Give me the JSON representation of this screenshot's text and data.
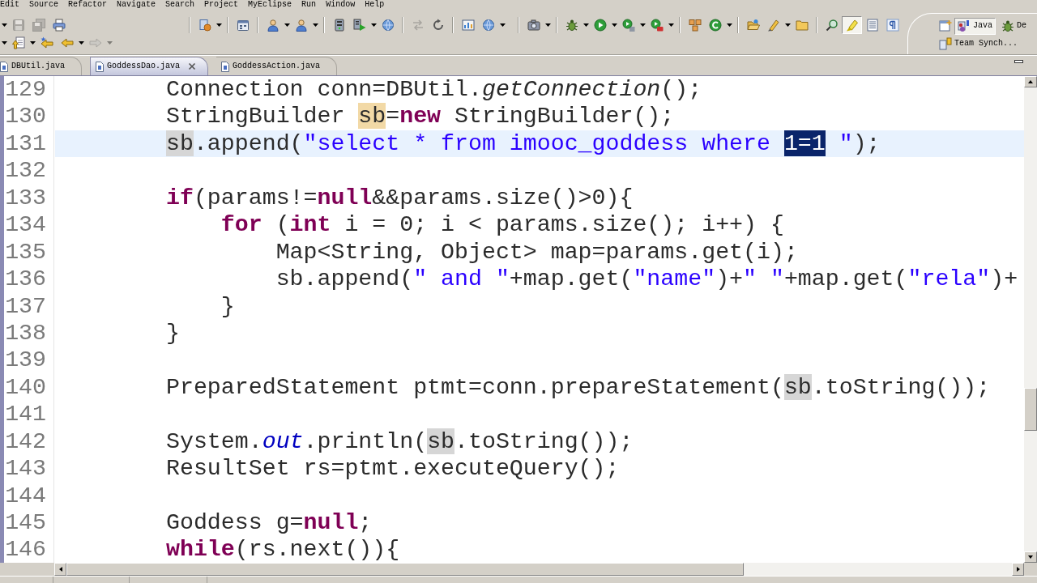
{
  "menu": [
    "Edit",
    "Source",
    "Refactor",
    "Navigate",
    "Search",
    "Project",
    "MyEclipse",
    "Run",
    "Window",
    "Help"
  ],
  "toolbar": [
    {
      "sections": [
        {
          "groups": [
            {
              "items": [
                {
                  "kind": "save",
                  "disabled": true,
                  "dropdown": false,
                  "pressed": false
                },
                {
                  "kind": "save-all",
                  "disabled": true,
                  "dropdown": false,
                  "pressed": false
                },
                {
                  "kind": "print",
                  "disabled": false,
                  "dropdown": false,
                  "pressed": false
                }
              ]
            }
          ]
        },
        {
          "groups": [
            {
              "items": [
                {
                  "kind": "document",
                  "disabled": false,
                  "dropdown": true,
                  "pressed": false
                }
              ]
            },
            {
              "items": [
                {
                  "kind": "calendar",
                  "disabled": false,
                  "dropdown": false,
                  "pressed": false
                }
              ]
            },
            {
              "items": [
                {
                  "kind": "person",
                  "disabled": false,
                  "dropdown": true,
                  "pressed": false
                },
                {
                  "kind": "person",
                  "disabled": false,
                  "dropdown": true,
                  "pressed": false
                }
              ]
            },
            {
              "items": [
                {
                  "kind": "server",
                  "disabled": false,
                  "dropdown": false,
                  "pressed": false
                },
                {
                  "kind": "server-play",
                  "disabled": false,
                  "dropdown": true,
                  "pressed": false
                },
                {
                  "kind": "globe",
                  "disabled": false,
                  "dropdown": false,
                  "pressed": false
                }
              ]
            },
            {
              "items": [
                {
                  "kind": "arrows",
                  "disabled": true,
                  "dropdown": false,
                  "pressed": false
                },
                {
                  "kind": "refresh",
                  "disabled": false,
                  "dropdown": false,
                  "pressed": false
                }
              ]
            },
            {
              "items": [
                {
                  "kind": "chart",
                  "disabled": false,
                  "dropdown": false,
                  "pressed": false
                },
                {
                  "kind": "globe",
                  "disabled": false,
                  "dropdown": true,
                  "pressed": false
                }
              ]
            }
          ]
        },
        {
          "groups": [
            {
              "items": [
                {
                  "kind": "camera",
                  "disabled": false,
                  "dropdown": true,
                  "pressed": false
                }
              ]
            },
            {
              "items": [
                {
                  "kind": "bug",
                  "disabled": false,
                  "dropdown": true,
                  "pressed": false
                },
                {
                  "kind": "play",
                  "disabled": false,
                  "dropdown": true,
                  "pressed": false
                },
                {
                  "kind": "play-list",
                  "disabled": false,
                  "dropdown": true,
                  "pressed": false
                },
                {
                  "kind": "play-stop",
                  "disabled": false,
                  "dropdown": true,
                  "pressed": false
                }
              ]
            },
            {
              "items": [
                {
                  "kind": "boxes",
                  "disabled": false,
                  "dropdown": false,
                  "pressed": false
                },
                {
                  "kind": "circle-arc",
                  "disabled": false,
                  "dropdown": true,
                  "pressed": false
                }
              ]
            },
            {
              "items": [
                {
                  "kind": "folder-open",
                  "disabled": false,
                  "dropdown": false,
                  "pressed": false
                },
                {
                  "kind": "pencil",
                  "disabled": false,
                  "dropdown": true,
                  "pressed": false
                },
                {
                  "kind": "folder",
                  "disabled": false,
                  "dropdown": false,
                  "pressed": false
                }
              ]
            },
            {
              "items": [
                {
                  "kind": "search",
                  "disabled": false,
                  "dropdown": false,
                  "pressed": false
                },
                {
                  "kind": "highlighter",
                  "disabled": false,
                  "dropdown": false,
                  "pressed": true
                },
                {
                  "kind": "text-lines",
                  "disabled": false,
                  "dropdown": false,
                  "pressed": false
                },
                {
                  "kind": "pilcrow",
                  "disabled": false,
                  "dropdown": false,
                  "pressed": false
                }
              ]
            }
          ]
        }
      ]
    },
    {
      "sections": [
        {
          "groups": [
            {
              "items": [
                {
                  "kind": "up-arrow",
                  "disabled": false,
                  "dropdown": true,
                  "pressed": false
                },
                {
                  "kind": "back-star",
                  "disabled": false,
                  "dropdown": false,
                  "pressed": false
                },
                {
                  "kind": "back",
                  "disabled": false,
                  "dropdown": true,
                  "pressed": false
                },
                {
                  "kind": "forward",
                  "disabled": true,
                  "dropdown": true,
                  "pressed": false
                }
              ]
            }
          ]
        }
      ]
    }
  ],
  "perspectives": [
    {
      "kind": "java",
      "label": "Java",
      "selected": true
    },
    {
      "kind": "debug",
      "label": "De",
      "selected": false
    },
    {
      "kind": "team",
      "label": "Team Synch...",
      "selected": false
    }
  ],
  "tabs": [
    {
      "label": "DBUtil.java",
      "selected": false
    },
    {
      "label": "GoddessDao.java",
      "selected": true
    },
    {
      "label": "GoddessAction.java",
      "selected": false
    }
  ],
  "editor": {
    "lines": [
      {
        "number": "129",
        "current": false,
        "tokens": [
          {
            "text": "        Connection conn=DBUtil.",
            "kind": "plain"
          },
          {
            "text": "getConnection",
            "kind": "static-method"
          },
          {
            "text": "();",
            "kind": "plain"
          }
        ]
      },
      {
        "number": "130",
        "current": false,
        "tokens": [
          {
            "text": "        StringBuilder ",
            "kind": "plain"
          },
          {
            "text": "sb",
            "kind": "write-occurrence"
          },
          {
            "text": "=",
            "kind": "plain"
          },
          {
            "text": "new",
            "kind": "keyword"
          },
          {
            "text": " StringBuilder();",
            "kind": "plain"
          }
        ]
      },
      {
        "number": "131",
        "current": true,
        "tokens": [
          {
            "text": "        sb",
            "kind": "occurrence"
          },
          {
            "text": ".append(",
            "kind": "plain"
          },
          {
            "text": "\"select * from imooc_goddess where ",
            "kind": "string"
          },
          {
            "text": "1=1",
            "kind": "selection"
          },
          {
            "text": " \"",
            "kind": "string"
          },
          {
            "text": ");",
            "kind": "plain"
          }
        ]
      },
      {
        "number": "132",
        "current": false
      },
      {
        "number": "133",
        "current": false,
        "tokens": [
          {
            "text": "        if",
            "kind": "keyword"
          },
          {
            "text": "(params!=",
            "kind": "plain"
          },
          {
            "text": "null",
            "kind": "keyword"
          },
          {
            "text": "&&params.size()>0){",
            "kind": "plain"
          }
        ]
      },
      {
        "number": "134",
        "current": false,
        "tokens": [
          {
            "text": "            for",
            "kind": "keyword"
          },
          {
            "text": " (",
            "kind": "plain"
          },
          {
            "text": "int",
            "kind": "keyword"
          },
          {
            "text": " i = 0; i < params.size(); i++) {",
            "kind": "plain"
          }
        ]
      },
      {
        "number": "135",
        "current": false,
        "tokens": [
          {
            "text": "                Map<String, Object> map=params.get(i);",
            "kind": "plain"
          }
        ]
      },
      {
        "number": "136",
        "current": false,
        "tokens": [
          {
            "text": "                sb.append(",
            "kind": "plain"
          },
          {
            "text": "\" and \"",
            "kind": "string"
          },
          {
            "text": "+map.get(",
            "kind": "plain"
          },
          {
            "text": "\"name\"",
            "kind": "string"
          },
          {
            "text": ")+",
            "kind": "plain"
          },
          {
            "text": "\" \"",
            "kind": "string"
          },
          {
            "text": "+map.get(",
            "kind": "plain"
          },
          {
            "text": "\"rela\"",
            "kind": "string"
          },
          {
            "text": ")+",
            "kind": "plain"
          }
        ]
      },
      {
        "number": "137",
        "current": false,
        "tokens": [
          {
            "text": "            }",
            "kind": "plain"
          }
        ]
      },
      {
        "number": "138",
        "current": false,
        "tokens": [
          {
            "text": "        }",
            "kind": "plain"
          }
        ]
      },
      {
        "number": "139",
        "current": false
      },
      {
        "number": "140",
        "current": false,
        "tokens": [
          {
            "text": "        PreparedStatement ptmt=conn.prepareStatement(",
            "kind": "plain"
          },
          {
            "text": "sb",
            "kind": "occurrence"
          },
          {
            "text": ".toString());",
            "kind": "plain"
          }
        ]
      },
      {
        "number": "141",
        "current": false
      },
      {
        "number": "142",
        "current": false,
        "tokens": [
          {
            "text": "        System.",
            "kind": "plain"
          },
          {
            "text": "out",
            "kind": "field"
          },
          {
            "text": ".println(",
            "kind": "plain"
          },
          {
            "text": "sb",
            "kind": "occurrence"
          },
          {
            "text": ".toString());",
            "kind": "plain"
          }
        ]
      },
      {
        "number": "143",
        "current": false,
        "tokens": [
          {
            "text": "        ResultSet rs=ptmt.executeQuery();",
            "kind": "plain"
          }
        ]
      },
      {
        "number": "144",
        "current": false
      },
      {
        "number": "145",
        "current": false,
        "tokens": [
          {
            "text": "        Goddess g=",
            "kind": "plain"
          },
          {
            "text": "null",
            "kind": "keyword"
          },
          {
            "text": ";",
            "kind": "plain"
          }
        ]
      },
      {
        "number": "146",
        "current": false,
        "tokens": [
          {
            "text": "        while",
            "kind": "keyword"
          },
          {
            "text": "(rs.next()){",
            "kind": "plain"
          }
        ]
      }
    ]
  }
}
